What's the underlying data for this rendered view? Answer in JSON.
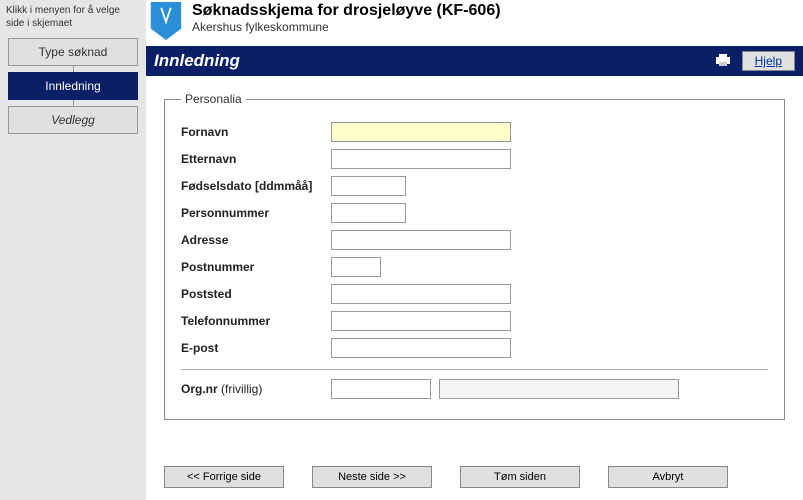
{
  "sidebar": {
    "hint": "Klikk i menyen for å velge side i skjemaet",
    "items": [
      {
        "label": "Type søknad"
      },
      {
        "label": "Innledning"
      },
      {
        "label": "Vedlegg"
      }
    ]
  },
  "header": {
    "title": "Søknadsskjema for drosjeløyve (KF-606)",
    "subtitle": "Akershus fylkeskommune"
  },
  "section": {
    "title": "Innledning",
    "help_label": "Hjelp"
  },
  "form": {
    "legend": "Personalia",
    "fields": {
      "fornavn": {
        "label": "Fornavn",
        "value": ""
      },
      "etternavn": {
        "label": "Etternavn",
        "value": ""
      },
      "fodselsdato": {
        "label": "Fødselsdato [ddmmåå]",
        "value": ""
      },
      "personnummer": {
        "label": "Personnummer",
        "value": ""
      },
      "adresse": {
        "label": "Adresse",
        "value": ""
      },
      "postnummer": {
        "label": "Postnummer",
        "value": ""
      },
      "poststed": {
        "label": "Poststed",
        "value": ""
      },
      "telefonnummer": {
        "label": "Telefonnummer",
        "value": ""
      },
      "epost": {
        "label": "E-post",
        "value": ""
      },
      "orgnr": {
        "label": "Org.nr",
        "optional": " (frivillig)",
        "value1": "",
        "value2": ""
      }
    }
  },
  "footer": {
    "prev": "<< Forrige side",
    "next": "Neste side >>",
    "clear": "Tøm siden",
    "cancel": "Avbryt"
  }
}
